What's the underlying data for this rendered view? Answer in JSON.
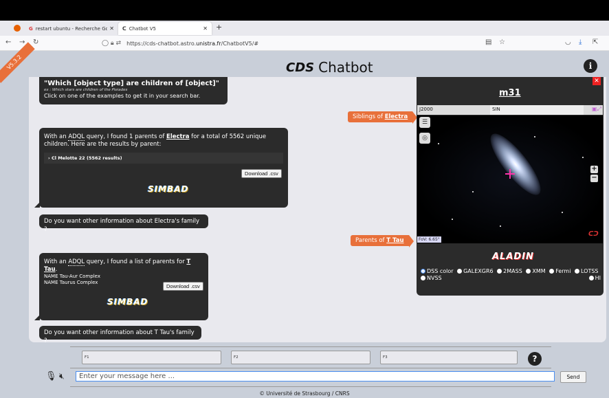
{
  "browser": {
    "tabs": [
      {
        "label": "restart ubuntu - Recherche Goo"
      },
      {
        "label": "Chatbot V5"
      }
    ],
    "url": {
      "prefix": "https://cds-chatbot.astro.",
      "domain": "unistra.fr",
      "path": "/ChatbotV5/#"
    }
  },
  "header": {
    "version": "V5.3.2",
    "logo": "CDS",
    "title": "Chatbot",
    "info_label": "i"
  },
  "chat": {
    "intro": {
      "question": "\"Which [object type] are children of [object]\"",
      "example": "ex : Which stars are children of the Pleiades",
      "hint": "Click on one of the examples to get it in your search bar."
    },
    "electra": {
      "line1_pre": "With an ",
      "adql": "ADQL",
      "line1_mid": " query, I found 1 parents of ",
      "name": "Electra",
      "line1_post": " for a total of 5562 unique",
      "line2": "children. Here are the results by parent:",
      "result_row": "› Cl Melotte 22 (5562 results)",
      "download": "Download .csv",
      "simbad": "SIMBAD"
    },
    "electra_followup": "Do you want other information about Electra's family ?",
    "ttau": {
      "pre": "With an ",
      "adql": "ADQL",
      "mid": " query, I found a list of parents for ",
      "name": "T Tau",
      "post": ".",
      "items": [
        "NAME Tau-Aur Complex",
        "NAME Taurus Complex"
      ],
      "download": "Download .csv",
      "simbad": "SIMBAD"
    },
    "ttau_followup": "Do you want other information about T Tau's family ?"
  },
  "tags": {
    "siblings_pre": "Siblings of ",
    "siblings_name": "Electra",
    "parents_pre": "Parents of ",
    "parents_name": "T Tau"
  },
  "aladin": {
    "title": "m31",
    "frame": "J2000",
    "projection": "SIN",
    "fov": "FoV: 6.65°",
    "logo": "ALADIN",
    "surveys": [
      {
        "label": "DSS color",
        "selected": true
      },
      {
        "label": "GALEXGR6",
        "selected": false
      },
      {
        "label": "2MASS",
        "selected": false
      },
      {
        "label": "XMM",
        "selected": false
      },
      {
        "label": "Fermi",
        "selected": false
      },
      {
        "label": "LOTSS",
        "selected": false
      },
      {
        "label": "HI",
        "selected": false
      },
      {
        "label": "NVSS",
        "selected": false
      }
    ]
  },
  "input": {
    "f1": "F1",
    "f2": "F2",
    "f3": "F3",
    "help": "?",
    "placeholder": "Enter your message here ...",
    "send": "Send"
  },
  "footer": "© Université de Strasbourg / CNRS",
  "colors": {
    "accent_orange": "#e8703a",
    "bubble": "#2b2b2b",
    "background": "#c9cfd9",
    "input_focus": "#4a8ef0"
  }
}
